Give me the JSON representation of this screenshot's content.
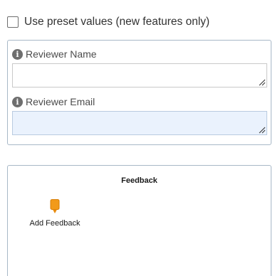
{
  "preset": {
    "label": "Use preset values (new features only)",
    "checked": false
  },
  "fields": [
    {
      "label": "Reviewer Name",
      "value": "",
      "info_icon": "info-icon"
    },
    {
      "label": "Reviewer Email",
      "value": "",
      "info_icon": "info-icon",
      "focused": true
    }
  ],
  "feedback": {
    "title": "Feedback",
    "add_label": "Add Feedback",
    "add_icon": "map-pin-icon",
    "pin_color": "#f29a1a"
  },
  "colors": {
    "panel_border": "#a8b8c7",
    "focused_input_bg": "#eaf2fd"
  }
}
